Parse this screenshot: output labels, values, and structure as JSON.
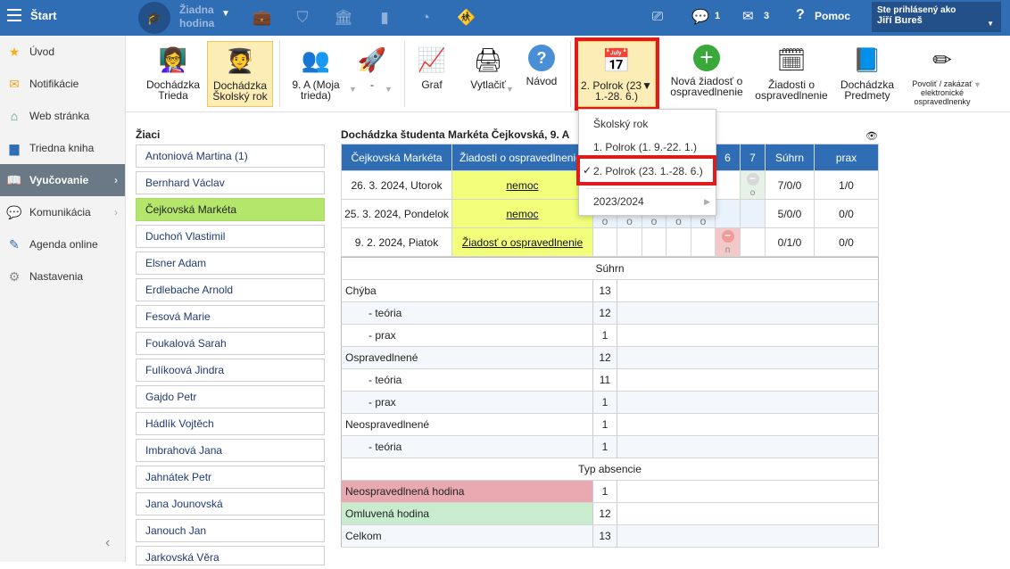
{
  "topbar": {
    "start_label": "Štart",
    "hodina_label_1": "Žiadna",
    "hodina_label_2": "hodina",
    "messages_count": "1",
    "mail_count": "3",
    "help_label": "Pomoc",
    "user_header": "Ste prihlásený ako",
    "user_name": "Jiří Bureš"
  },
  "sidebar": {
    "items": [
      {
        "label": "Úvod",
        "icon": "star-icon"
      },
      {
        "label": "Notifikácie",
        "icon": "envelope-icon"
      },
      {
        "label": "Web stránka",
        "icon": "home-icon"
      },
      {
        "label": "Triedna kniha",
        "icon": "book-icon"
      },
      {
        "label": "Vyučovanie",
        "icon": "open-book-icon"
      },
      {
        "label": "Komunikácia",
        "icon": "chat-icon"
      },
      {
        "label": "Agenda online",
        "icon": "pen-icon"
      },
      {
        "label": "Nastavenia",
        "icon": "gear-icon"
      }
    ]
  },
  "ribbon": {
    "b1_l1": "Dochádzka",
    "b1_l2": "Trieda",
    "b2_l1": "Dochádzka",
    "b2_l2": "Školský rok",
    "b3_l1": "9. A (Moja",
    "b3_l2": "trieda)",
    "b4": "-",
    "b5": "Graf",
    "b6": "Vytlačiť",
    "b7": "Návod",
    "b8_l1": "2. Polrok (23",
    "b8_l2": "1.-28. 6.)",
    "b9_l1": "Nová žiadosť o",
    "b9_l2": "ospravedlnenie",
    "b10_l1": "Žiadosti o",
    "b10_l2": "ospravedlnenie",
    "b11_l1": "Dochádzka",
    "b11_l2": "Predmety",
    "b12_l1": "Povoliť / zakázať",
    "b12_l2": "elektronické",
    "b12_l3": "ospravedlnenky"
  },
  "dropdown": {
    "i1": "Školský rok",
    "i2": "1. Polrok (1. 9.-22. 1.)",
    "i3": "2. Polrok (23. 1.-28. 6.)",
    "i4": "2023/2024"
  },
  "students": {
    "heading": "Žiaci",
    "list": [
      "Antoniová Martina (1)",
      "Bernhard Václav",
      "Čejkovská Markéta",
      "Duchoň Vlastimil",
      "Elsner Adam",
      "Erdlebache Arnold",
      "Fesová Marie",
      "Foukalová Sarah",
      "Fulíkoová Jindra",
      "Gajdo Petr",
      "Hádlík Vojtěch",
      "Imbrahová Jana",
      "Jahnátek Petr",
      "Jana Jounovská",
      "Janouch Jan",
      "Jarkovská Věra"
    ]
  },
  "main": {
    "title": "Dochádzka študenta Markéta Čejkovská, 9. A",
    "col_name": "Čejkovská Markéta",
    "col_req": "Žiadosti o ospravedlnenie",
    "col_5": "5",
    "col_6": "6",
    "col_7": "7",
    "col_sum": "Súhrn",
    "col_prax": "prax",
    "rows": [
      {
        "date": "26. 3. 2024, Utorok",
        "req": "nemoc",
        "sum": "7/0/0",
        "prax": "1/0"
      },
      {
        "date": "25. 3. 2024, Pondelok",
        "req": "nemoc",
        "sum": "5/0/0",
        "prax": "0/0"
      },
      {
        "date": "9. 2. 2024, Piatok",
        "req": "Žiadosť o ospravedlnenie",
        "sum": "0/1/0",
        "prax": "0/0"
      }
    ],
    "mark_o": "o",
    "mark_n": "n",
    "summary_header": "Súhrn",
    "summary": [
      {
        "label": "Chýba",
        "value": "13"
      },
      {
        "label": "- teória",
        "value": "12"
      },
      {
        "label": "- prax",
        "value": "1"
      },
      {
        "label": "Ospravedlnené",
        "value": "12"
      },
      {
        "label": "- teória",
        "value": "11"
      },
      {
        "label": "- prax",
        "value": "1"
      },
      {
        "label": "Neospravedlnené",
        "value": "1"
      },
      {
        "label": "- teória",
        "value": "1"
      }
    ],
    "type_header": "Typ absencie",
    "types": [
      {
        "label": "Neospravedlnená hodina",
        "value": "1",
        "color": "#e9a9b1"
      },
      {
        "label": "Omluvená hodina",
        "value": "12",
        "color": "#c9eccf"
      },
      {
        "label": "Celkom",
        "value": "13",
        "color": "#f4f8fd"
      }
    ]
  }
}
